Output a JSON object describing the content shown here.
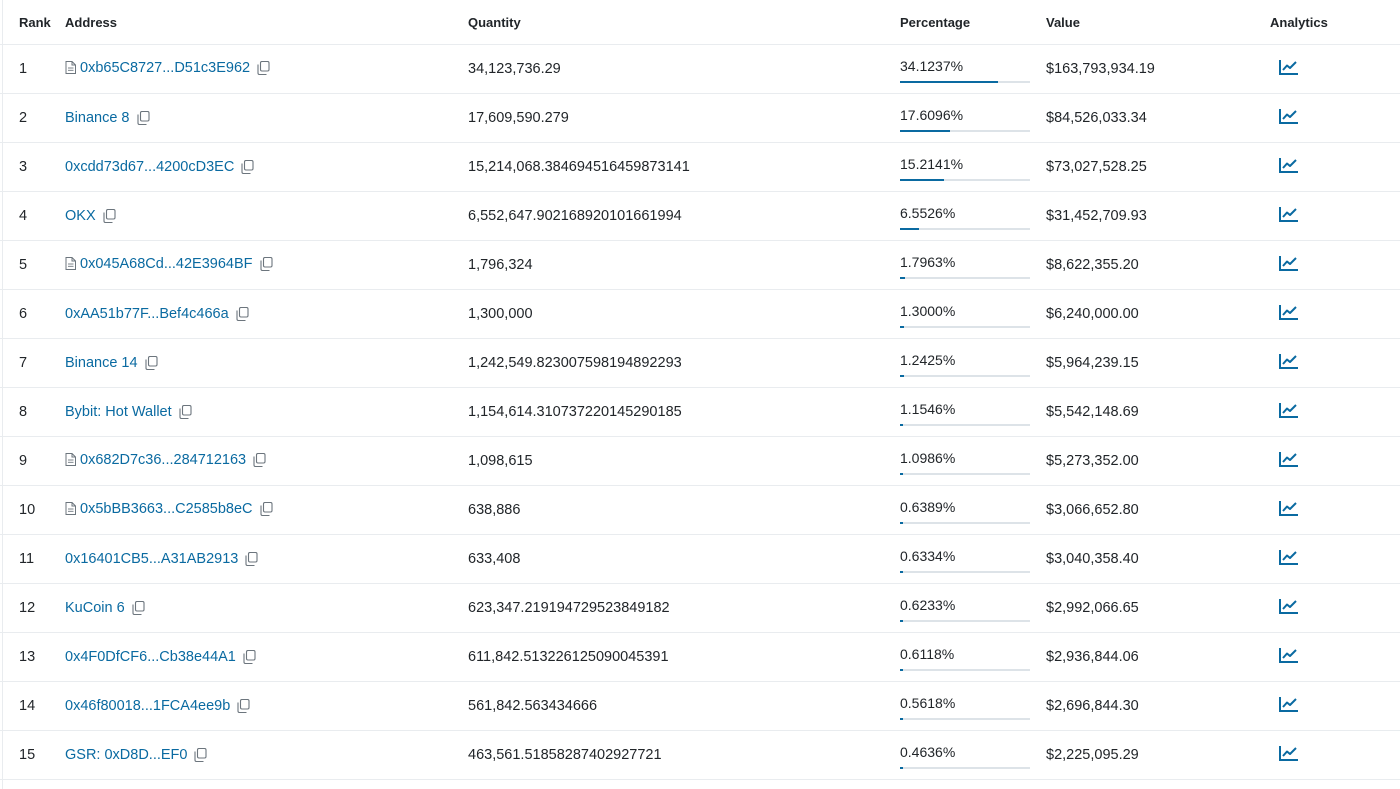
{
  "table": {
    "headers": {
      "rank": "Rank",
      "address": "Address",
      "quantity": "Quantity",
      "percentage": "Percentage",
      "value": "Value",
      "analytics": "Analytics"
    },
    "rows": [
      {
        "rank": "1",
        "address": "0xb65C8727...D51c3E962",
        "contract": true,
        "quantity": "34,123,736.29",
        "percentage": "34.1237%",
        "pct_value": 34.1237,
        "value": "$163,793,934.19"
      },
      {
        "rank": "2",
        "address": "Binance 8",
        "contract": false,
        "quantity": "17,609,590.279",
        "percentage": "17.6096%",
        "pct_value": 17.6096,
        "value": "$84,526,033.34"
      },
      {
        "rank": "3",
        "address": "0xcdd73d67...4200cD3EC",
        "contract": false,
        "quantity": "15,214,068.384694516459873141",
        "percentage": "15.2141%",
        "pct_value": 15.2141,
        "value": "$73,027,528.25"
      },
      {
        "rank": "4",
        "address": "OKX",
        "contract": false,
        "quantity": "6,552,647.902168920101661994",
        "percentage": "6.5526%",
        "pct_value": 6.5526,
        "value": "$31,452,709.93"
      },
      {
        "rank": "5",
        "address": "0x045A68Cd...42E3964BF",
        "contract": true,
        "quantity": "1,796,324",
        "percentage": "1.7963%",
        "pct_value": 1.7963,
        "value": "$8,622,355.20"
      },
      {
        "rank": "6",
        "address": "0xAA51b77F...Bef4c466a",
        "contract": false,
        "quantity": "1,300,000",
        "percentage": "1.3000%",
        "pct_value": 1.3,
        "value": "$6,240,000.00"
      },
      {
        "rank": "7",
        "address": "Binance 14",
        "contract": false,
        "quantity": "1,242,549.823007598194892293",
        "percentage": "1.2425%",
        "pct_value": 1.2425,
        "value": "$5,964,239.15"
      },
      {
        "rank": "8",
        "address": "Bybit: Hot Wallet",
        "contract": false,
        "quantity": "1,154,614.310737220145290185",
        "percentage": "1.1546%",
        "pct_value": 1.1546,
        "value": "$5,542,148.69"
      },
      {
        "rank": "9",
        "address": "0x682D7c36...284712163",
        "contract": true,
        "quantity": "1,098,615",
        "percentage": "1.0986%",
        "pct_value": 1.0986,
        "value": "$5,273,352.00"
      },
      {
        "rank": "10",
        "address": "0x5bBB3663...C2585b8eC",
        "contract": true,
        "quantity": "638,886",
        "percentage": "0.6389%",
        "pct_value": 0.6389,
        "value": "$3,066,652.80"
      },
      {
        "rank": "11",
        "address": "0x16401CB5...A31AB2913",
        "contract": false,
        "quantity": "633,408",
        "percentage": "0.6334%",
        "pct_value": 0.6334,
        "value": "$3,040,358.40"
      },
      {
        "rank": "12",
        "address": "KuCoin 6",
        "contract": false,
        "quantity": "623,347.219194729523849182",
        "percentage": "0.6233%",
        "pct_value": 0.6233,
        "value": "$2,992,066.65"
      },
      {
        "rank": "13",
        "address": "0x4F0DfCF6...Cb38e44A1",
        "contract": false,
        "quantity": "611,842.513226125090045391",
        "percentage": "0.6118%",
        "pct_value": 0.6118,
        "value": "$2,936,844.06"
      },
      {
        "rank": "14",
        "address": "0x46f80018...1FCA4ee9b",
        "contract": false,
        "quantity": "561,842.563434666",
        "percentage": "0.5618%",
        "pct_value": 0.5618,
        "value": "$2,696,844.30"
      },
      {
        "rank": "15",
        "address": "GSR: 0xD8D...EF0",
        "contract": false,
        "quantity": "463,561.51858287402927721",
        "percentage": "0.4636%",
        "pct_value": 0.4636,
        "value": "$2,225,095.29"
      }
    ]
  },
  "icons": {
    "contract": "file-document-icon",
    "copy": "copy-icon",
    "analytics": "line-chart-icon"
  },
  "colors": {
    "link": "#0a6aa1",
    "bar_fill": "#0a6aa1",
    "bar_track": "#dde3e8",
    "border": "#e9ecef"
  }
}
